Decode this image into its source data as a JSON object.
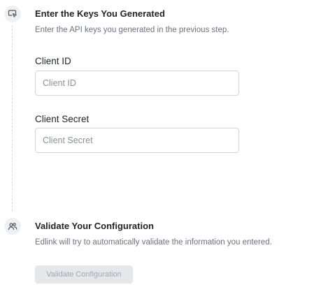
{
  "steps": [
    {
      "icon": "cursor-click-icon",
      "title": "Enter the Keys You Generated",
      "description": "Enter the API keys you generated in the previous step."
    },
    {
      "icon": "users-icon",
      "title": "Validate Your Configuration",
      "description": "Edlink will try to automatically validate the information you entered."
    }
  ],
  "fields": {
    "client_id": {
      "label": "Client ID",
      "placeholder": "Client ID",
      "value": ""
    },
    "client_secret": {
      "label": "Client Secret",
      "placeholder": "Client Secret",
      "value": ""
    }
  },
  "validate_button": {
    "label": "Validate Configuration",
    "state": "disabled"
  }
}
